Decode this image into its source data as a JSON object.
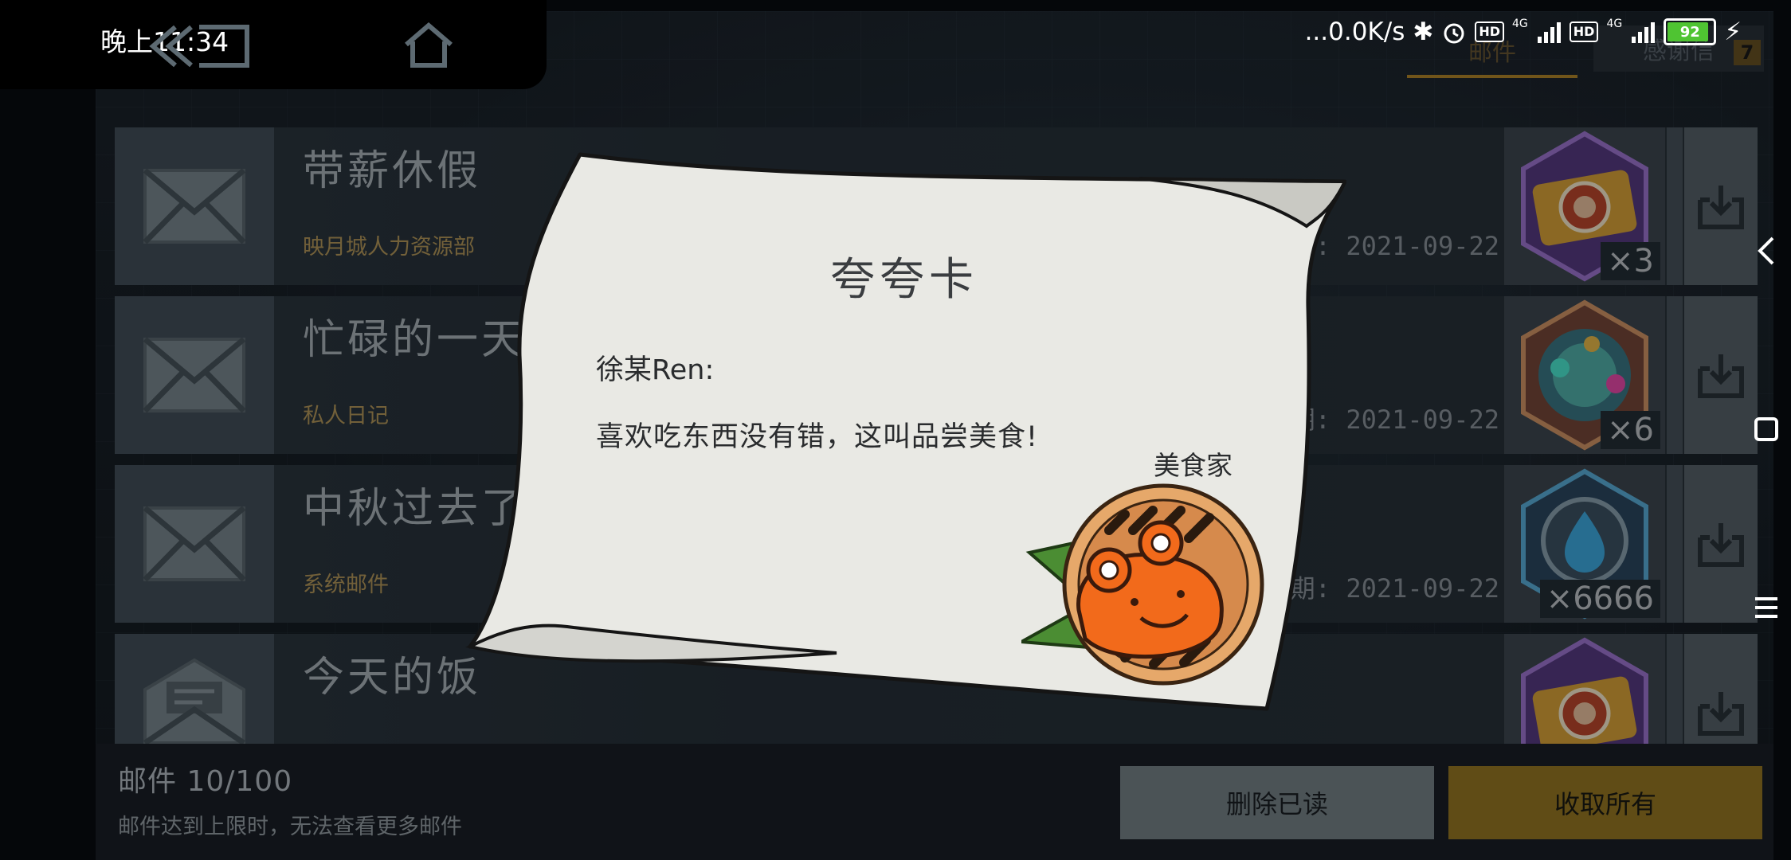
{
  "status_bar": {
    "time": "晚上11:34",
    "net_speed": "...0.0K/s",
    "hd_label": "HD",
    "net_type": "4G",
    "battery": "92"
  },
  "tabs": {
    "mail_label": "邮件",
    "thanks_label": "感谢信",
    "thanks_badge": "7"
  },
  "mails": [
    {
      "title": "带薪休假",
      "sender": "映月城人力资源部",
      "date": ": 2021-09-22",
      "qty": "×3",
      "reward_icon": "ticket-icon"
    },
    {
      "title": "忙碌的一天",
      "sender": "私人日记",
      "date": "期: 2021-09-22",
      "qty": "×6",
      "reward_icon": "gear-orb-icon"
    },
    {
      "title": "中秋过去了",
      "sender": "系统邮件",
      "date": "期: 2021-09-22",
      "qty": "×6666",
      "reward_icon": "water-drop-icon"
    },
    {
      "title": "今天的饭",
      "sender": "",
      "date": "",
      "qty": "",
      "reward_icon": "ticket-icon"
    }
  ],
  "footer": {
    "count": "邮件 10/100",
    "limit_notice": "邮件达到上限时，无法查看更多邮件",
    "delete_read": "删除已读",
    "collect_all": "收取所有"
  },
  "letter": {
    "title": "夸夸卡",
    "recipient": "徐某Ren:",
    "body": "喜欢吃东西没有错，这叫品尝美食!",
    "signature": "美食家",
    "badge_icon": "crab-dish-icon"
  },
  "colors": {
    "accent_gold": "#9b7b25",
    "paper": "#e9e9e4",
    "panel": "#2e3942"
  }
}
